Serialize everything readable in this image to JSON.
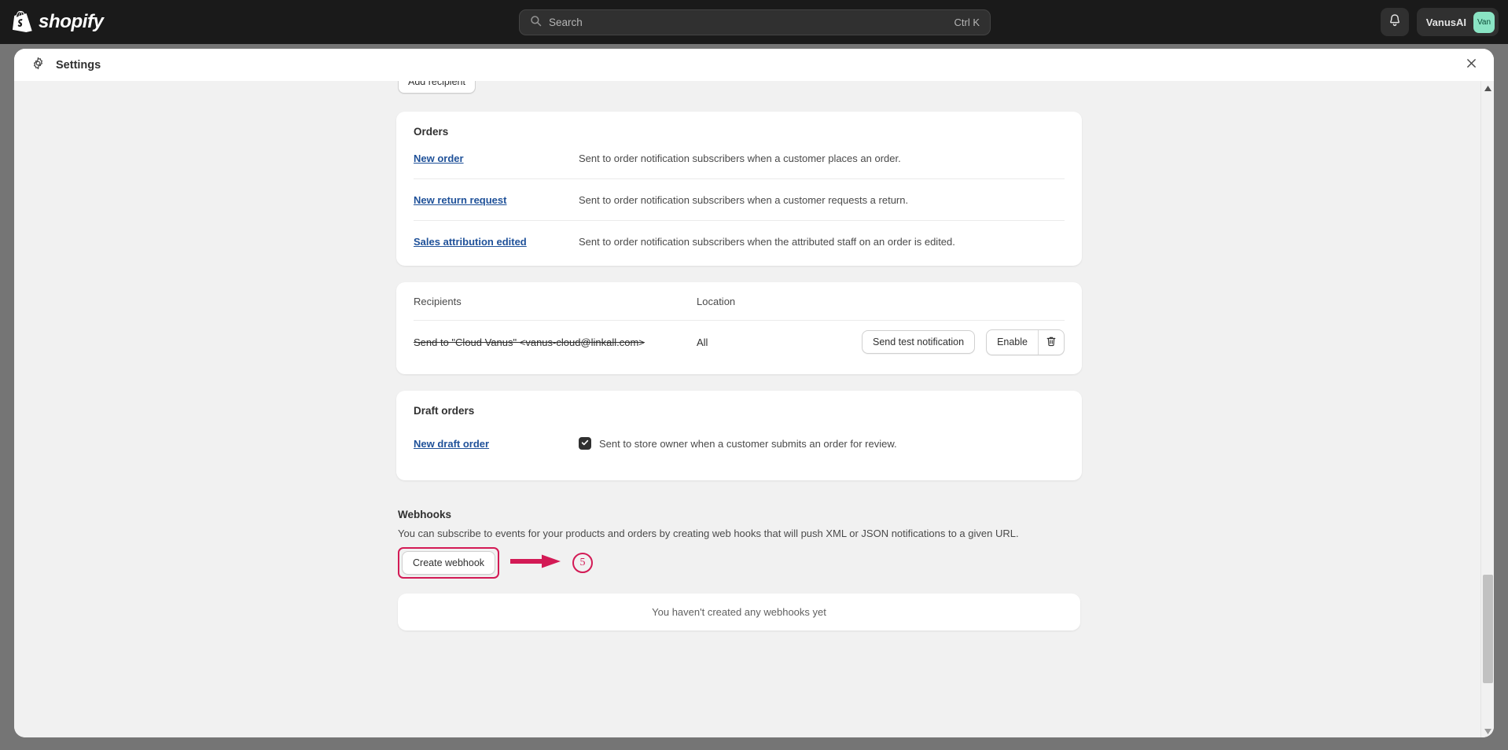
{
  "topbar": {
    "brand": "shopify",
    "logo_icon": "shopify-bag-icon",
    "search": {
      "icon": "search-icon",
      "placeholder": "Search",
      "shortcut": "Ctrl K",
      "value": ""
    },
    "notifications_icon": "bell-icon",
    "user": {
      "name": "VanusAI",
      "avatar_initials": "Van",
      "avatar_color": "#8ae4c4"
    }
  },
  "modal": {
    "title": "Settings",
    "gear_icon": "gear-icon",
    "close_icon": "close-icon"
  },
  "toolbar": {
    "add_recipient_label": "Add recipient"
  },
  "orders_card": {
    "title": "Orders",
    "rows": [
      {
        "link": "New order",
        "description": "Sent to order notification subscribers when a customer places an order."
      },
      {
        "link": "New return request",
        "description": "Sent to order notification subscribers when a customer requests a return."
      },
      {
        "link": "Sales attribution edited",
        "description": "Sent to order notification subscribers when the attributed staff on an order is edited."
      }
    ]
  },
  "recipients_card": {
    "columns": {
      "recipients": "Recipients",
      "location": "Location"
    },
    "rows": [
      {
        "recipient": "Send to \"Cloud Vanus\" <vanus-cloud@linkall.com>",
        "location": "All",
        "test_label": "Send test notification",
        "enable_label": "Enable",
        "delete_icon": "trash-icon"
      }
    ]
  },
  "draft_orders_card": {
    "title": "Draft orders",
    "link": "New draft order",
    "checkbox_checked": true,
    "description": "Sent to store owner when a customer submits an order for review."
  },
  "webhooks": {
    "title": "Webhooks",
    "description": "You can subscribe to events for your products and orders by creating web hooks that will push XML or JSON notifications to a given URL.",
    "create_label": "Create webhook",
    "empty_state": "You haven't created any webhooks yet"
  },
  "annotation": {
    "step_number": "5",
    "color": "#d31a55",
    "arrow_icon": "arrow-right-icon"
  },
  "scrollbar": {
    "up_icon": "caret-up-icon",
    "down_icon": "caret-down-icon"
  }
}
